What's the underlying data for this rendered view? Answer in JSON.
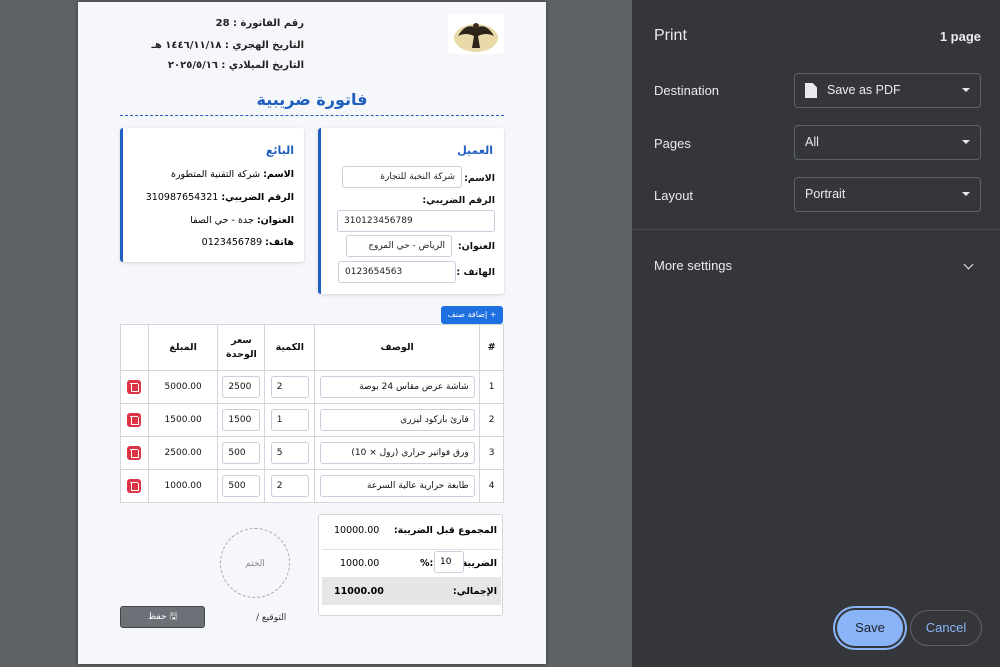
{
  "invoice": {
    "number_line": "رقم الفاتورة : 28",
    "hijri_line": "التاريخ الهجري : ١٤٤٦/١١/١٨ هـ",
    "gregorian_line": "التاريخ الميلادي : ٢٠٢٥/٥/١٦",
    "title": "فاتورة ضريبية"
  },
  "customer": {
    "heading": "العميل",
    "name_label": "الاسم:",
    "name_value": "شركة النخبة للتجارة",
    "tax_label": "الرقم الضريبي:",
    "tax_value": "310123456789",
    "address_label": "العنوان:",
    "address_value": "الرياض - حي المروج",
    "phone_label": "الهاتف :",
    "phone_value": "0123654563"
  },
  "seller": {
    "heading": "البائع",
    "name_label": "الاسم:",
    "name_value": "شركة التقنية المتطورة",
    "tax_label": "الرقم الضريبي:",
    "tax_value": "310987654321",
    "address_label": "العنوان:",
    "address_value": "جدة - حي الصفا",
    "phone_label": "هاتف:",
    "phone_value": "0123456789"
  },
  "add_item_label": "+ إضافة صنف",
  "table": {
    "headers": {
      "num": "#",
      "desc": "الوصف",
      "qty": "الكمية",
      "price": "سعر الوحدة",
      "amount": "المبلغ"
    },
    "rows": [
      {
        "num": "1",
        "desc": "شاشة عرض مقاس 24 بوصة",
        "qty": "2",
        "price": "2500",
        "amount": "5000.00"
      },
      {
        "num": "2",
        "desc": "قارئ باركود ليزري",
        "qty": "1",
        "price": "1500",
        "amount": "1500.00"
      },
      {
        "num": "3",
        "desc": "ورق فواتير حراري (رول × 10)",
        "qty": "5",
        "price": "500",
        "amount": "2500.00"
      },
      {
        "num": "4",
        "desc": "طابعة حرارية عالية السرعة",
        "qty": "2",
        "price": "500",
        "amount": "1000.00"
      }
    ]
  },
  "totals": {
    "subtotal_label": "المجموع قبل الضريبة:",
    "subtotal_value": "10000.00",
    "tax_label": "الضريبة",
    "tax_percent": "10",
    "tax_percent_suffix": "%:",
    "tax_value": "1000.00",
    "total_label": "الإجمالي:",
    "total_value": "11000.00"
  },
  "stamp_label": "الختم",
  "signature_label": "التوقيع /",
  "save_invoice_label": "حفظ",
  "print_panel": {
    "title": "Print",
    "sheet_count": "1 page",
    "destination_label": "Destination",
    "destination_value": "Save as PDF",
    "pages_label": "Pages",
    "pages_value": "All",
    "layout_label": "Layout",
    "layout_value": "Portrait",
    "more_settings": "More settings",
    "save_button": "Save",
    "cancel_button": "Cancel",
    "accent_color": "#8ab4f8",
    "background_color": "#35363a"
  }
}
